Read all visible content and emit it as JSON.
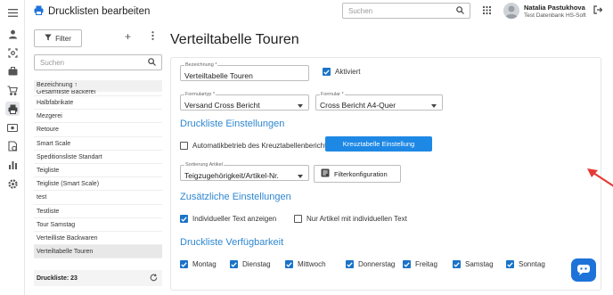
{
  "app": {
    "title": "Drucklisten bearbeiten"
  },
  "topbar": {
    "search_placeholder": "Suchen",
    "user_name": "Natalia Pastukhova",
    "user_org": "Test Datenbank HS-Soft"
  },
  "rail": {
    "icons": [
      "menu-icon",
      "person-icon",
      "camera-scan-icon",
      "briefcase-icon",
      "cart-icon",
      "printer-icon",
      "cash-icon",
      "document-icon",
      "report-clock-icon",
      "chart-icon",
      "gear-icon"
    ]
  },
  "listpanel": {
    "filter_label": "Filter",
    "search_placeholder": "Suchen",
    "column_header": "Bezeichnung ↑",
    "items": [
      "Gesamtliste Bäckerei",
      "Halbfabrikate",
      "Mezgerei",
      "Retoure",
      "Smart Scale",
      "Speditionsliste Standart",
      "Teigliste",
      "Teigliste (Smart Scale)",
      "test",
      "Testliste",
      "Tour Samstag",
      "Verteilliste Backwaren",
      "Verteiltabelle Touren"
    ],
    "selected_index": 12,
    "footer_count": "Druckliste: 23"
  },
  "main": {
    "page_title": "Verteiltabelle Touren",
    "bezeichnung": {
      "label": "Bezeichnung *",
      "value": "Verteiltabelle Touren"
    },
    "aktiviert": {
      "label": "Aktiviert",
      "checked": true
    },
    "formulartyp": {
      "label": "Formulartyp *",
      "value": "Versand Cross Bericht"
    },
    "formular": {
      "label": "Formular *",
      "value": "Cross Bericht A4-Quer"
    },
    "section_einstellungen": "Druckliste Einstellungen",
    "automatik": {
      "label": "Automatikbetrieb des Kreuztabellenberichts",
      "checked": false
    },
    "kreuztabelle_button": "Kreuztabelle Einstellung",
    "sortierung": {
      "label": "Sortierung Artikel",
      "value": "Teigzugehörigkeit/Artikel-Nr."
    },
    "filter_button": "Filterkonfiguration",
    "section_zusaetzlich": "Zusätzliche Einstellungen",
    "individueller_text": {
      "label": "Individueller Text anzeigen",
      "checked": true
    },
    "nur_artikel": {
      "label": "Nur Artikel mit individuellen Text",
      "checked": false
    },
    "section_verfuegbarkeit": "Druckliste Verfügbarkeit",
    "days": [
      {
        "label": "Montag",
        "checked": true
      },
      {
        "label": "Dienstag",
        "checked": true
      },
      {
        "label": "Mittwoch",
        "checked": true
      },
      {
        "label": "Donnerstag",
        "checked": true
      },
      {
        "label": "Freitag",
        "checked": true
      },
      {
        "label": "Samstag",
        "checked": true
      },
      {
        "label": "Sonntag",
        "checked": true
      }
    ]
  },
  "colors": {
    "accent": "#1e88e5",
    "section": "#2f87d0",
    "annotation_arrow": "#e53935"
  }
}
